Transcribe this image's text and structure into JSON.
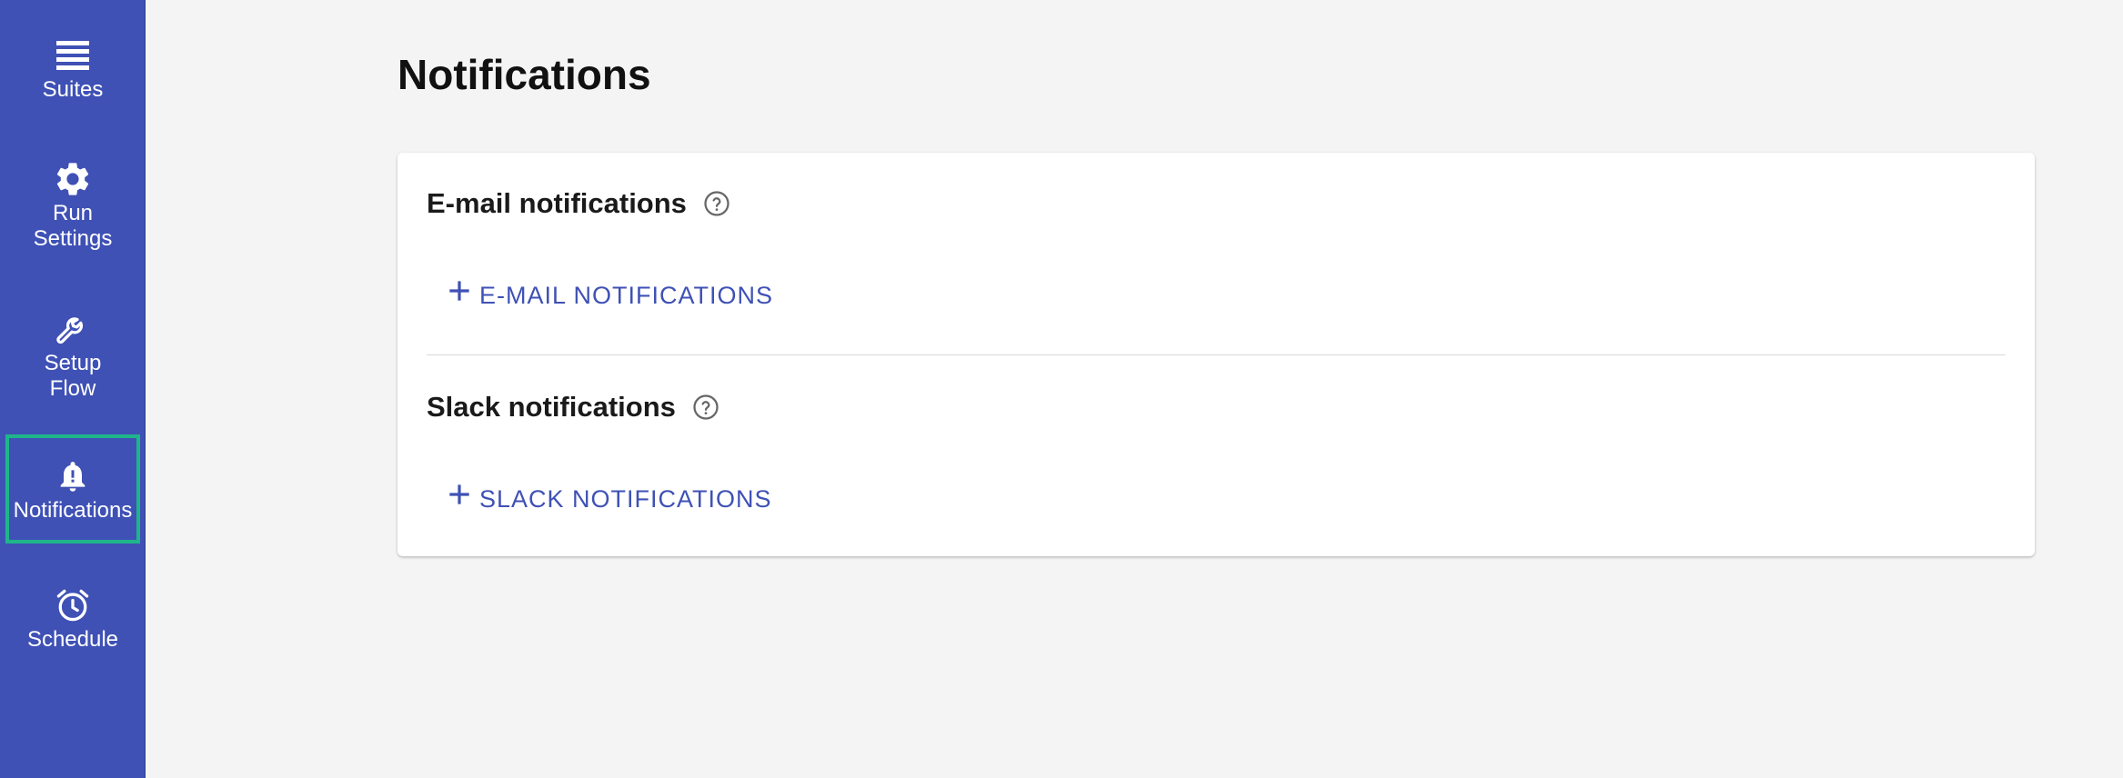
{
  "sidebar": {
    "items": [
      {
        "label": "Suites",
        "icon": "menu-list-icon"
      },
      {
        "label": "Run\nSettings",
        "icon": "gear-icon"
      },
      {
        "label": "Setup\nFlow",
        "icon": "wrench-icon"
      },
      {
        "label": "Notifications",
        "icon": "bell-alert-icon",
        "active": true
      },
      {
        "label": "Schedule",
        "icon": "alarm-clock-icon"
      }
    ]
  },
  "page": {
    "title": "Notifications"
  },
  "email": {
    "title": "E-mail notifications",
    "add_label": "E-MAIL NOTIFICATIONS"
  },
  "slack": {
    "title": "Slack notifications",
    "add_label": "SLACK NOTIFICATIONS"
  },
  "colors": {
    "sidebar_bg": "#3f51b5",
    "accent": "#3f51b5",
    "active_outline": "#1fb58a",
    "page_bg": "#f4f4f4"
  }
}
